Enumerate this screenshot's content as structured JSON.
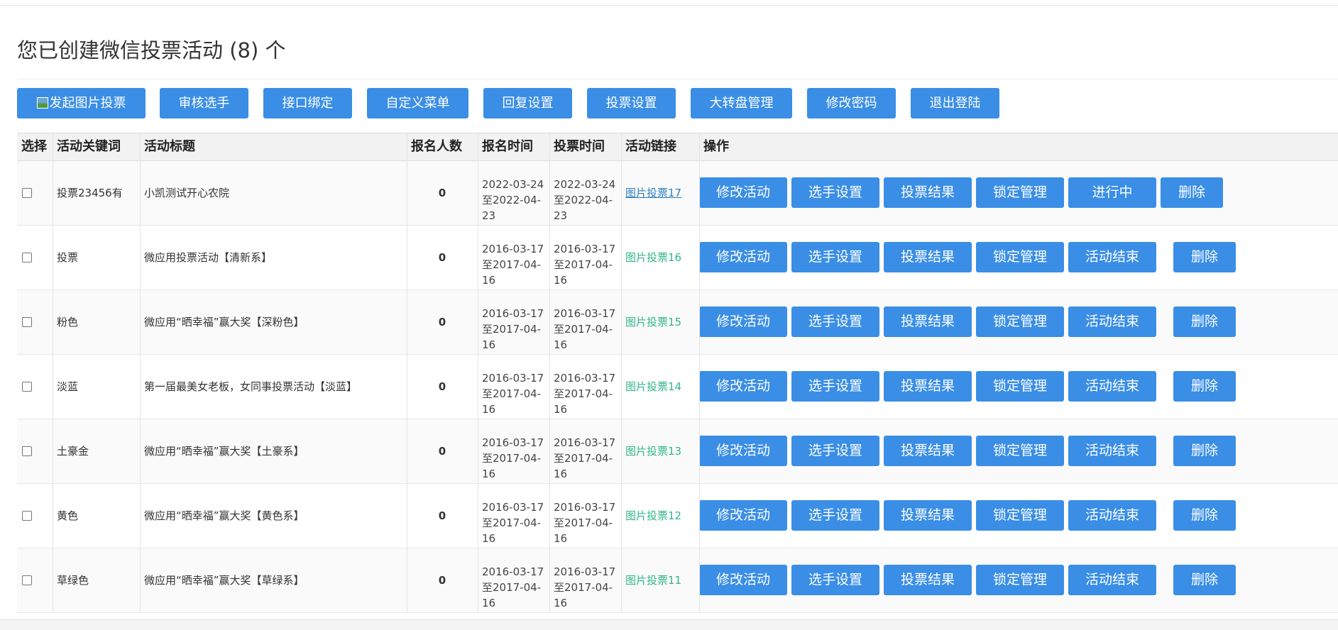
{
  "page_title": "您已创建微信投票活动 (8) 个",
  "toolbar": {
    "new_picture_vote": "发起图片投票",
    "review_contestants": "审核选手",
    "api_binding": "接口绑定",
    "custom_menu": "自定义菜单",
    "reply_settings": "回复设置",
    "vote_settings": "投票设置",
    "wheel_management": "大转盘管理",
    "change_password": "修改密码",
    "logout": "退出登陆"
  },
  "table": {
    "headers": {
      "select": "选择",
      "keyword": "活动关键词",
      "title": "活动标题",
      "signups": "报名人数",
      "signup_time": "报名时间",
      "vote_time": "投票时间",
      "link": "活动链接",
      "actions": "操作"
    },
    "action_labels": {
      "edit": "修改活动",
      "contestants": "选手设置",
      "results": "投票结果",
      "lock": "锁定管理",
      "delete": "删除"
    },
    "rows": [
      {
        "keyword": "投票23456有",
        "title": "小凯测试开心农院",
        "signups": "0",
        "signup_time": "2022-03-24至2022-04-23",
        "vote_time": "2022-03-24至2022-04-23",
        "link": "图片投票17",
        "status": "进行中"
      },
      {
        "keyword": "投票",
        "title": "微应用投票活动【清新系】",
        "signups": "0",
        "signup_time": "2016-03-17至2017-04-16",
        "vote_time": "2016-03-17至2017-04-16",
        "link": "图片投票16",
        "status": "活动结束"
      },
      {
        "keyword": "粉色",
        "title": "微应用“晒幸福”赢大奖【深粉色】",
        "signups": "0",
        "signup_time": "2016-03-17至2017-04-16",
        "vote_time": "2016-03-17至2017-04-16",
        "link": "图片投票15",
        "status": "活动结束"
      },
      {
        "keyword": "淡蓝",
        "title": "第一届最美女老板，女同事投票活动【淡蓝】",
        "signups": "0",
        "signup_time": "2016-03-17至2017-04-16",
        "vote_time": "2016-03-17至2017-04-16",
        "link": "图片投票14",
        "status": "活动结束"
      },
      {
        "keyword": "土豪金",
        "title": "微应用“晒幸福”赢大奖【土豪系】",
        "signups": "0",
        "signup_time": "2016-03-17至2017-04-16",
        "vote_time": "2016-03-17至2017-04-16",
        "link": "图片投票13",
        "status": "活动结束"
      },
      {
        "keyword": "黄色",
        "title": "微应用“晒幸福”赢大奖【黄色系】",
        "signups": "0",
        "signup_time": "2016-03-17至2017-04-16",
        "vote_time": "2016-03-17至2017-04-16",
        "link": "图片投票12",
        "status": "活动结束"
      },
      {
        "keyword": "草绿色",
        "title": "微应用“晒幸福”赢大奖【草绿系】",
        "signups": "0",
        "signup_time": "2016-03-17至2017-04-16",
        "vote_time": "2016-03-17至2017-04-16",
        "link": "图片投票11",
        "status": "活动结束"
      }
    ]
  },
  "colors": {
    "button_blue": "#3a8ee6",
    "link_green": "#2fb58a",
    "link_blue": "#2b7fbf"
  }
}
